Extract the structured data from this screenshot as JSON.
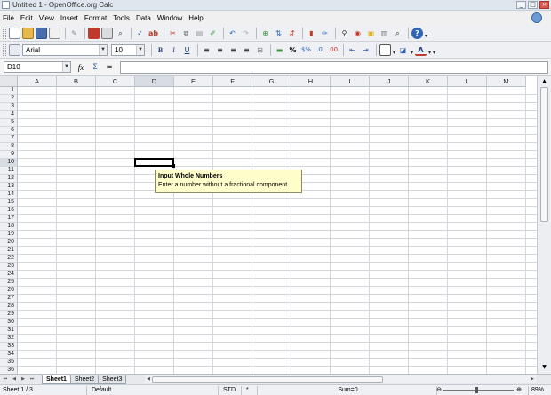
{
  "window": {
    "title": "Untitled 1 - OpenOffice.org Calc",
    "controls": [
      "_",
      "□",
      "×"
    ]
  },
  "menu": [
    "File",
    "Edit",
    "View",
    "Insert",
    "Format",
    "Tools",
    "Data",
    "Window",
    "Help"
  ],
  "toolbar": {
    "font_name": "Arial",
    "font_size": "10",
    "bold": "B",
    "italic": "I",
    "underline": "U",
    "percent": "%",
    "colors": {
      "accent_red": "#c0392b",
      "accent_blue": "#2f64b6",
      "accent_green": "#3d9140",
      "accent_yellow": "#e0b020"
    }
  },
  "formula_bar": {
    "cell_ref": "D10",
    "fx": "fx",
    "sum": "Σ",
    "equals": "=",
    "value": ""
  },
  "sheet": {
    "columns": [
      "A",
      "B",
      "C",
      "D",
      "E",
      "F",
      "G",
      "H",
      "I",
      "J",
      "K",
      "L",
      "M"
    ],
    "rows": [
      "1",
      "2",
      "3",
      "4",
      "5",
      "6",
      "7",
      "8",
      "9",
      "10",
      "11",
      "12",
      "13",
      "14",
      "15",
      "16",
      "17",
      "18",
      "19",
      "20",
      "21",
      "22",
      "23",
      "24",
      "25",
      "26",
      "27",
      "28",
      "29",
      "30",
      "31",
      "32",
      "33",
      "34",
      "35",
      "36"
    ],
    "active_col": "D",
    "active_row": "10"
  },
  "tooltip": {
    "title": "Input Whole Numbers",
    "message": "Enter a number without a fractional component."
  },
  "tabs": [
    "Sheet1",
    "Sheet2",
    "Sheet3"
  ],
  "status": {
    "sheet": "Sheet 1 / 3",
    "style": "Default",
    "mode": "STD",
    "modified": "*",
    "sum": "Sum=0",
    "zoom": "89%"
  }
}
